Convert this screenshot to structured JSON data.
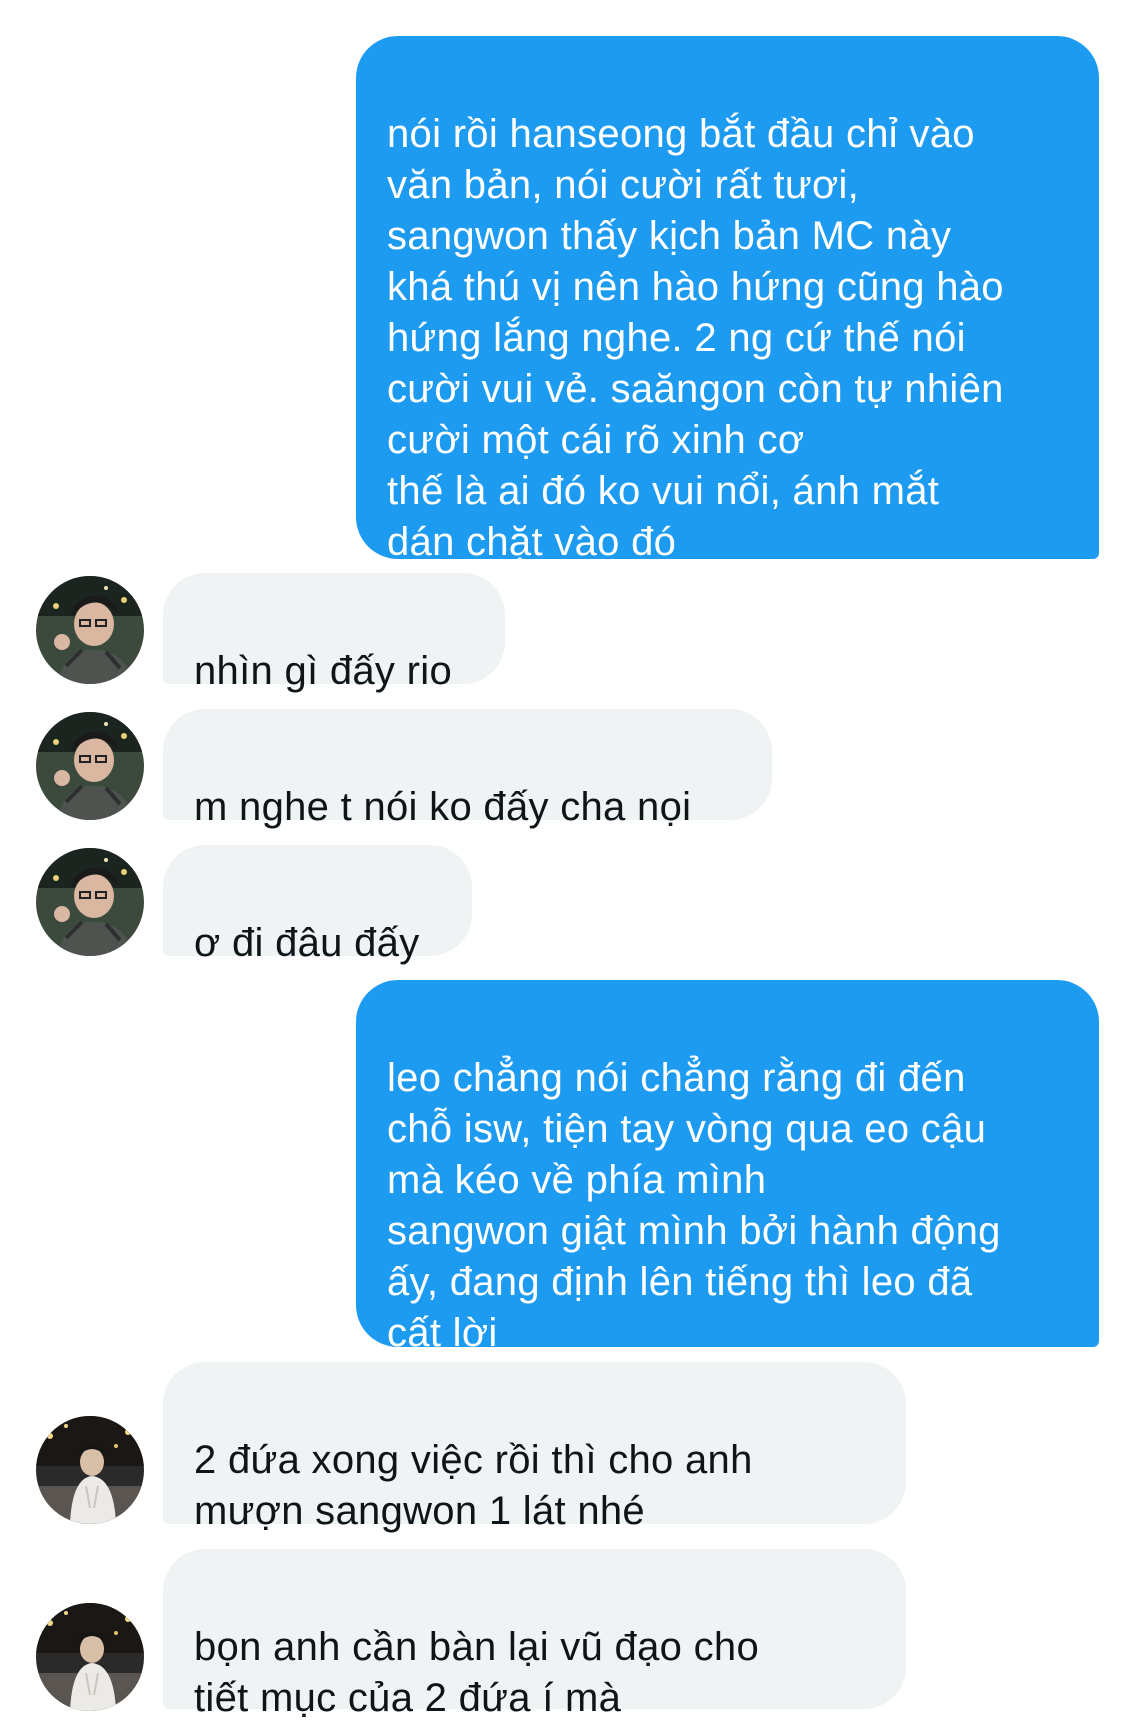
{
  "messages": [
    {
      "direction": "outgoing",
      "text": "nói rồi hanseong bắt đầu chỉ vào\nvăn bản, nói cười rất tươi,\nsangwon thấy kịch bản MC này\nkhá thú vị nên hào hứng cũng hào\nhứng lắng nghe. 2 ng cứ thế nói\ncười vui vẻ. saăngon còn tự nhiên\ncười một cái rõ xinh cơ\nthế là ai đó ko vui nổi, ánh mắt\ndán chặt vào đó"
    },
    {
      "direction": "incoming",
      "sender": "avatar-1",
      "text": "nhìn gì đấy rio"
    },
    {
      "direction": "incoming",
      "sender": "avatar-1",
      "text": "m nghe t nói ko đấy cha nọi"
    },
    {
      "direction": "incoming",
      "sender": "avatar-1",
      "text": "ơ đi đâu đấy"
    },
    {
      "direction": "outgoing",
      "text": "leo chẳng nói chẳng rằng đi đến\nchỗ isw, tiện tay vòng qua eo cậu\nmà kéo về phía mình\nsangwon giật mình bởi hành động\nấy, đang định lên tiếng thì leo đã\ncất lời"
    },
    {
      "direction": "incoming",
      "sender": "avatar-2",
      "text": "2 đứa xong việc rồi thì cho anh\nmượn sangwon 1 lát nhé"
    },
    {
      "direction": "incoming",
      "sender": "avatar-2",
      "text": "bọn anh cần bàn lại vũ đạo cho\ntiết mục của 2 đứa í mà"
    }
  ],
  "colors": {
    "outgoing_bubble": "#1d9bf0",
    "incoming_bubble": "#eff3f4",
    "outgoing_text": "#ffffff",
    "incoming_text": "#0f1419"
  }
}
